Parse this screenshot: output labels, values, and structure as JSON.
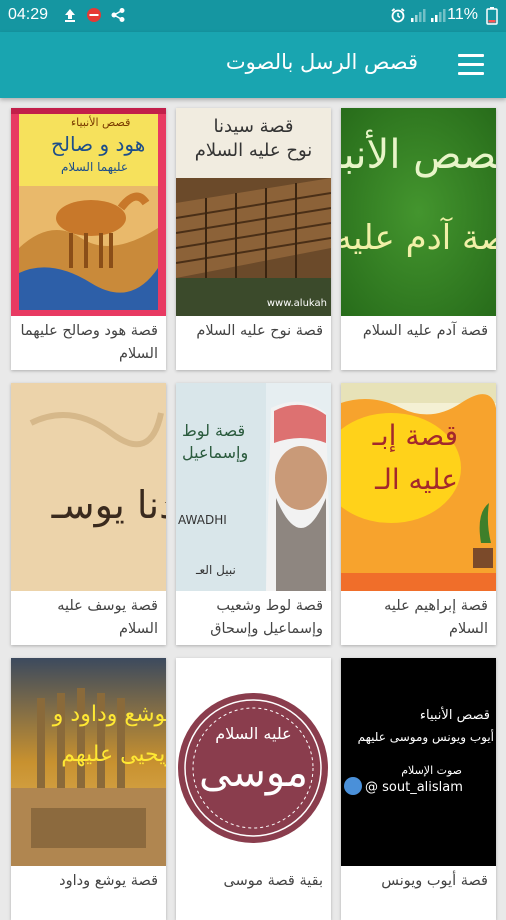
{
  "status": {
    "time": "04:29",
    "battery": "11%"
  },
  "appbar": {
    "title": "قصص الرسل بالصوت"
  },
  "stories": [
    {
      "label": "قصة آدم عليه السلام",
      "thumb_text": [
        "قصص الأنبيـ",
        "قصة آدم عليه السـ"
      ]
    },
    {
      "label": "قصة نوح عليه السلام",
      "thumb_text": [
        "قصة سيدنا",
        "نوح عليه السلام",
        "www.alukah"
      ]
    },
    {
      "label": "قصة هود وصالح عليهما السلام",
      "thumb_text": [
        "قصص الأنبياء",
        "هود و صالح",
        "عليهما السلام"
      ]
    },
    {
      "label": "قصة إبراهيم عليه السلام",
      "thumb_text": [
        "قصة إبـ",
        "عليه الـ"
      ]
    },
    {
      "label": "قصة لوط وشعيب وإسماعيل وإسحاق",
      "thumb_text": [
        "قصة لوط",
        "وإسماعيل",
        "AWADHI",
        "نبيل العـ"
      ]
    },
    {
      "label": "قصة يوسف عليه السلام",
      "thumb_text": [
        "دنا يوسـ"
      ]
    },
    {
      "label": "قصة أيوب ويونس",
      "thumb_text": [
        "قصص الأنبياء",
        "أيوب ويونس وموسى عليهم",
        "صوت الإسلام",
        "@ sout_alislam"
      ]
    },
    {
      "label": "بقية قصة موسى",
      "thumb_text": [
        "موسى",
        "عليه السلام"
      ]
    },
    {
      "label": "قصة يوشع وداود",
      "thumb_text": [
        "يوشع وداود و",
        "ويحيى عليهم"
      ]
    }
  ],
  "colors": {
    "status_bar": "#1596a1",
    "app_bar": "#19a5b0",
    "background": "#e9e9e9"
  }
}
